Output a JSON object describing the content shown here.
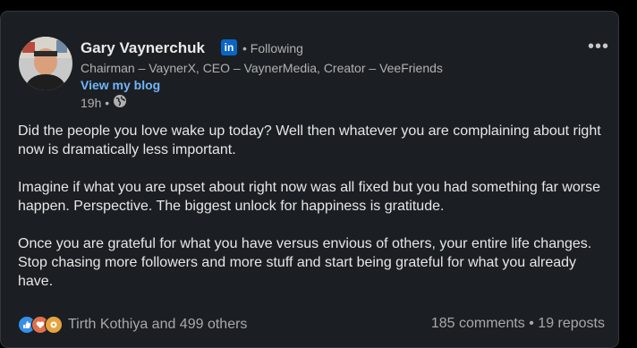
{
  "author": {
    "name": "Gary Vaynerchuk",
    "badge": "in",
    "follow_status": "• Following",
    "headline": "Chairman – VaynerX, CEO – VaynerMedia, Creator – VeeFriends",
    "blog_link": "View my blog",
    "time": "19h •"
  },
  "menu_label": "•••",
  "post": {
    "paragraphs": [
      "Did the people you love wake up today? Well then whatever you are complaining about right now is dramatically less important.",
      "Imagine if what you are upset about right now was all fixed but you had something far worse happen. Perspective. The biggest unlock for happiness is gratitude.",
      "Once you are grateful for what you have versus envious of others, your entire life changes. Stop chasing more followers and more stuff and start being grateful for what you already have."
    ]
  },
  "social": {
    "reactions_text": "Tirth Kothiya and 499 others",
    "stats_text": "185 comments • 19 reposts",
    "icons": [
      "like-icon",
      "love-icon",
      "care-icon"
    ]
  },
  "colors": {
    "card_bg": "#1b1f23",
    "accent_link": "#70b5f9",
    "linkedin_blue": "#0a66c2"
  }
}
